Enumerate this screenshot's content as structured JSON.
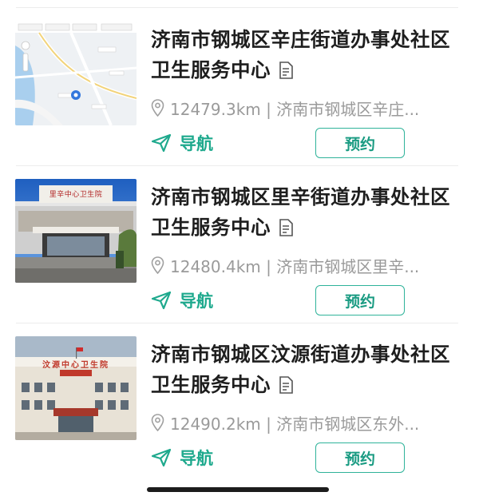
{
  "clinics": [
    {
      "name": "济南市钢城区辛庄街道办事处社区卫生服务中心",
      "address": "12479.3km | 济南市钢城区辛庄...",
      "nav_label": "导航",
      "book_label": "预约",
      "thumbnail": "map-thumbnail"
    },
    {
      "name": "济南市钢城区里辛街道办事处社区卫生服务中心",
      "address": "12480.4km | 济南市钢城区里辛...",
      "nav_label": "导航",
      "book_label": "预约",
      "thumbnail": "building-photo",
      "sign_text": "里辛中心卫生院"
    },
    {
      "name": "济南市钢城区汶源街道办事处社区卫生服务中心",
      "address": "12490.2km | 济南市钢城区东外...",
      "nav_label": "导航",
      "book_label": "预约",
      "thumbnail": "building-photo",
      "sign_text": "汶源中心卫生院"
    }
  ],
  "colors": {
    "accent": "#1ea98d",
    "button_border": "#2fb39a",
    "title_text": "#1e1e1e",
    "secondary_text": "#9a9a9a"
  }
}
